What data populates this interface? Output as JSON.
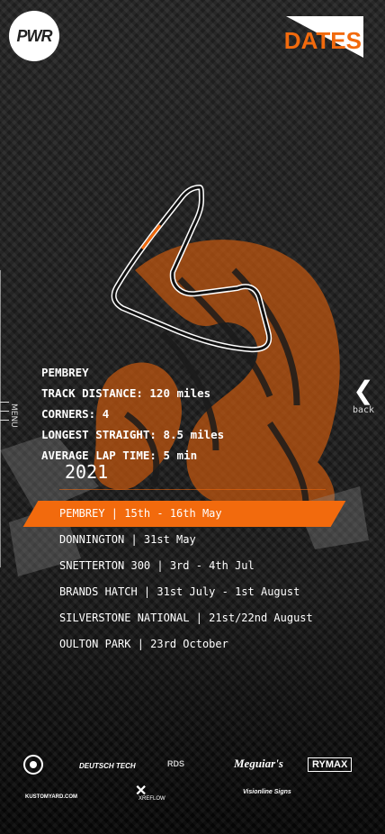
{
  "header": {
    "logo_text": "PWR",
    "page_title": "DATES"
  },
  "nav": {
    "menu_label": "MENU",
    "back_label": "back"
  },
  "track": {
    "name": "PEMBREY",
    "distance": "TRACK DISTANCE: 120 miles",
    "corners": "CORNERS: 4",
    "longest_straight": "LONGEST STRAIGHT: 8.5 miles",
    "average_lap": "AVERAGE LAP TIME: 5 min"
  },
  "season": {
    "year": "2021",
    "races": [
      {
        "label": "PEMBREY | 15th - 16th May",
        "active": true
      },
      {
        "label": "DONNINGTON | 31st May",
        "active": false
      },
      {
        "label": "SNETTERTON 300 | 3rd - 4th Jul",
        "active": false
      },
      {
        "label": "BRANDS HATCH | 31st July - 1st August",
        "active": false
      },
      {
        "label": "SILVERSTONE NATIONAL | 21st/22nd August",
        "active": false
      },
      {
        "label": "OULTON PARK | 23rd October",
        "active": false
      }
    ]
  },
  "sponsors": [
    "DEUTSCH TECH",
    "RDS",
    "Meguiar's",
    "RYMAX",
    "KUSTOMYARD.COM",
    "XREFLOW",
    "Visionline Signs"
  ],
  "colors": {
    "accent": "#f26a0d"
  }
}
